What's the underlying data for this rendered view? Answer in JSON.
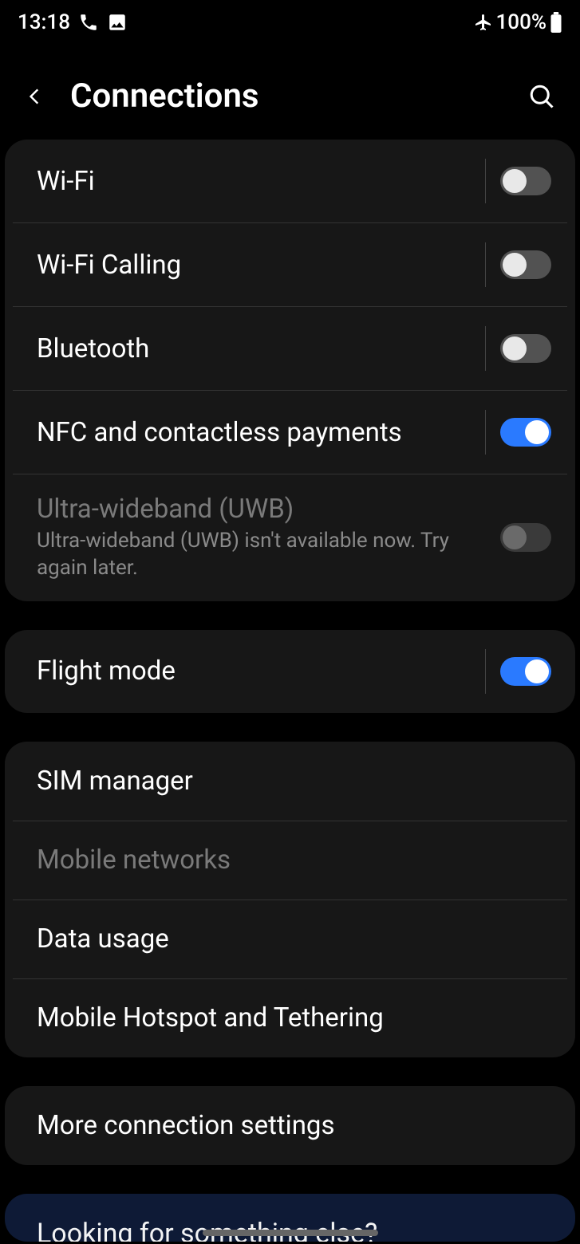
{
  "status": {
    "time": "13:18",
    "battery_text": "100%"
  },
  "header": {
    "title": "Connections"
  },
  "group1": {
    "wifi": {
      "label": "Wi-Fi",
      "on": false
    },
    "wifi_calling": {
      "label": "Wi-Fi Calling",
      "on": false
    },
    "bluetooth": {
      "label": "Bluetooth",
      "on": false
    },
    "nfc": {
      "label": "NFC and contactless payments",
      "on": true
    },
    "uwb": {
      "label": "Ultra-wideband (UWB)",
      "sub": "Ultra-wideband (UWB) isn't available now. Try again later.",
      "on": false,
      "disabled": true
    }
  },
  "group2": {
    "flight": {
      "label": "Flight mode",
      "on": true
    }
  },
  "group3": {
    "sim": {
      "label": "SIM manager"
    },
    "mobile_networks": {
      "label": "Mobile networks",
      "disabled": true
    },
    "data_usage": {
      "label": "Data usage"
    },
    "hotspot": {
      "label": "Mobile Hotspot and Tethering"
    }
  },
  "group4": {
    "more": {
      "label": "More connection settings"
    }
  },
  "suggestion": {
    "title": "Looking for something else?"
  }
}
